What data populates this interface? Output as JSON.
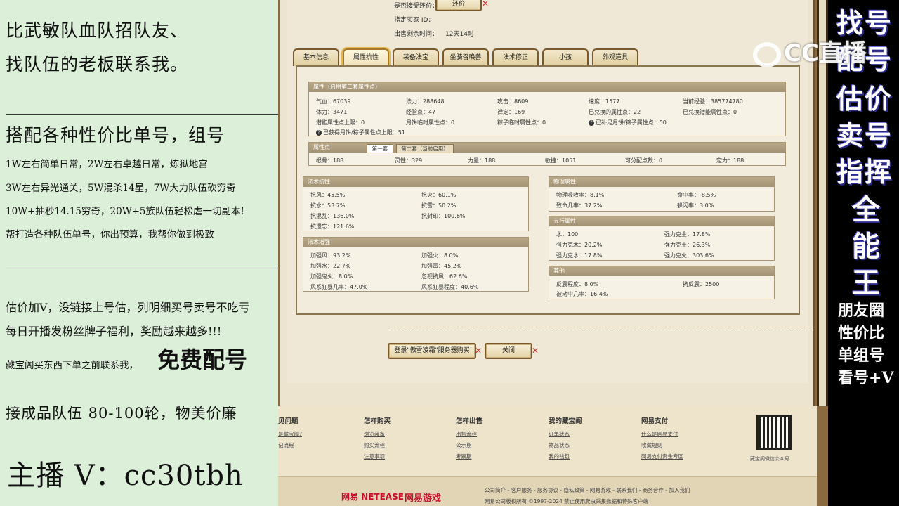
{
  "left_overlay": {
    "line1": "比武敏队血队招队友、",
    "line2": "找队伍的老板联系我。",
    "line3": "搭配各种性价比单号，组号",
    "line4": "1W左右简单日常，2W左右卓越日常，炼狱地宫",
    "line5": "3W左右异光通关，5W混杀14星，7W大力队伍砍穷奇",
    "line6": "10W+抽秒14.15穷奇，20W+5族队伍轻松虐一切副本!",
    "line7": "帮打造各种队伍单号，你出预算，我帮你做到极致",
    "line8": "估价加V，没链接上号估，列明细买号卖号不吃亏",
    "line9": "每日开播发粉丝牌子福利，奖励越来越多!!!",
    "line10": "藏宝阁买东西下单之前联系我，",
    "free_match": "免费配号",
    "line11": "接成品队伍 80-100轮，物美价廉",
    "anchor": "主播 V：cc30tbh"
  },
  "right_overlay": {
    "chars": [
      "找号",
      "配号",
      "估价",
      "卖号",
      "指挥",
      "全",
      "能",
      "王"
    ],
    "lines": [
      "朋友圈",
      "性价比",
      "单组号",
      "看号+V"
    ]
  },
  "watermark": {
    "text": "CC直播"
  },
  "game": {
    "info": {
      "bargain_label": "是否接受还价：",
      "bargain_button": "还价",
      "buyer_label": "指定买家 ID：",
      "remaining_label": "出售剩余时间：",
      "remaining_value": "12天14时"
    },
    "tabs": [
      "基本信息",
      "属性抗性",
      "装备法宝",
      "坐骑召唤兽",
      "法术修正",
      "小孩",
      "外观道具"
    ],
    "active_tab": 1,
    "attributes": {
      "header": "属性（启用第二套属性点）",
      "row1": [
        {
          "label": "气血：",
          "value": "67039"
        },
        {
          "label": "法力：",
          "value": "288648"
        },
        {
          "label": "攻击：",
          "value": "8609"
        },
        {
          "label": "速度：",
          "value": "1577"
        },
        {
          "label": "当前经验：",
          "value": "385774780"
        }
      ],
      "row2": [
        {
          "label": "体力：",
          "value": "3471"
        },
        {
          "label": "经验点：",
          "value": "47"
        },
        {
          "label": "禅定：",
          "value": "169"
        },
        {
          "label": "已兑换的属性点：",
          "value": "22"
        },
        {
          "label": "已兑换潜能属性点：",
          "value": "0"
        }
      ],
      "row3": [
        {
          "label": "潜能属性点上限：",
          "value": "0"
        },
        {
          "label": "月饼临时属性点：",
          "value": "0"
        },
        {
          "label": "粽子临时属性点：",
          "value": "0"
        },
        {
          "label": "已补足月饼/粽子属性点：",
          "value": "50"
        }
      ],
      "row4": {
        "label": "已获得月饼/粽子属性点上限：",
        "value": "51"
      }
    },
    "points": {
      "header": "属性点",
      "sub_tab1": "第一套",
      "sub_tab2": "第二套（当前启用）",
      "values": [
        {
          "label": "根骨：",
          "value": "188"
        },
        {
          "label": "灵性：",
          "value": "329"
        },
        {
          "label": "力量：",
          "value": "188"
        },
        {
          "label": "敏捷：",
          "value": "1051"
        },
        {
          "label": "可分配点数：",
          "value": "0"
        },
        {
          "label": "定力：",
          "value": "188"
        }
      ]
    },
    "resist": {
      "header": "法术抗性",
      "items": [
        {
          "label": "抗风：",
          "value": "45.5%"
        },
        {
          "label": "抗火：",
          "value": "60.1%"
        },
        {
          "label": "抗水：",
          "value": "53.7%"
        },
        {
          "label": "抗雷：",
          "value": "50.2%"
        },
        {
          "label": "抗混乱：",
          "value": "136.0%"
        },
        {
          "label": "抗封印：",
          "value": "100.6%"
        },
        {
          "label": "抗遗忘：",
          "value": "121.6%"
        }
      ]
    },
    "enhance": {
      "header": "法术增强",
      "items": [
        {
          "label": "加强风：",
          "value": "93.2%"
        },
        {
          "label": "加强火：",
          "value": "8.0%"
        },
        {
          "label": "加强水：",
          "value": "22.7%"
        },
        {
          "label": "加强雷：",
          "value": "45.2%"
        },
        {
          "label": "加强鬼火：",
          "value": "8.0%"
        },
        {
          "label": "忽视抗风：",
          "value": "62.6%"
        },
        {
          "label": "风系狂暴几率：",
          "value": "47.0%"
        },
        {
          "label": "风系狂暴程度：",
          "value": "40.6%"
        }
      ]
    },
    "physical": {
      "header": "物理属性",
      "items": [
        {
          "label": "物理吸收率：",
          "value": "8.1%"
        },
        {
          "label": "命中率：",
          "value": "-8.5%"
        },
        {
          "label": "致命几率：",
          "value": "37.2%"
        },
        {
          "label": "躲闪率：",
          "value": "3.0%"
        }
      ]
    },
    "five": {
      "header": "五行属性",
      "items": [
        {
          "label": "水：",
          "value": "100"
        },
        {
          "label": "强力克金：",
          "value": "17.8%"
        },
        {
          "label": "强力克木：",
          "value": "20.2%"
        },
        {
          "label": "强力克土：",
          "value": "26.3%"
        },
        {
          "label": "强力克水：",
          "value": "17.8%"
        },
        {
          "label": "强力克火：",
          "value": "303.6%"
        }
      ]
    },
    "other": {
      "header": "其他",
      "items": [
        {
          "label": "反震程度：",
          "value": "8.0%"
        },
        {
          "label": "抗反震：",
          "value": "2500"
        },
        {
          "label": "被动中几率：",
          "value": "16.4%"
        }
      ]
    },
    "buttons": {
      "login_buy": "登录\"傲雪凌霜\"服务器购买",
      "close": "关闭"
    }
  },
  "footer": {
    "columns": [
      {
        "title": "见问题",
        "links": [
          "是藏宝阁?",
          "记流程"
        ]
      },
      {
        "title": "怎样购买",
        "links": [
          "浏览装备",
          "购买流程",
          "注意事项"
        ]
      },
      {
        "title": "怎样出售",
        "links": [
          "出售流程",
          "公示期",
          "考察期"
        ]
      },
      {
        "title": "我的藏宝阁",
        "links": [
          "订单状态",
          "物品状态",
          "我的钱包"
        ]
      },
      {
        "title": "网易支付",
        "links": [
          "什么是网易支付",
          "收藏规则",
          "网易支付资金专区"
        ]
      }
    ],
    "qr_label": "藏宝阁微信公众号",
    "netease": "网易 NETEASE",
    "netgame": "网易游戏",
    "bottom_line1": "公司简介 - 客户服务 - 服务协议 - 隐私政策 - 网易游戏 - 联系我们 - 商务合作 - 加入我们",
    "bottom_line2": "网易公司版权所有 ©1997-2024  禁止使用爬虫采集数据和特殊客户端"
  }
}
